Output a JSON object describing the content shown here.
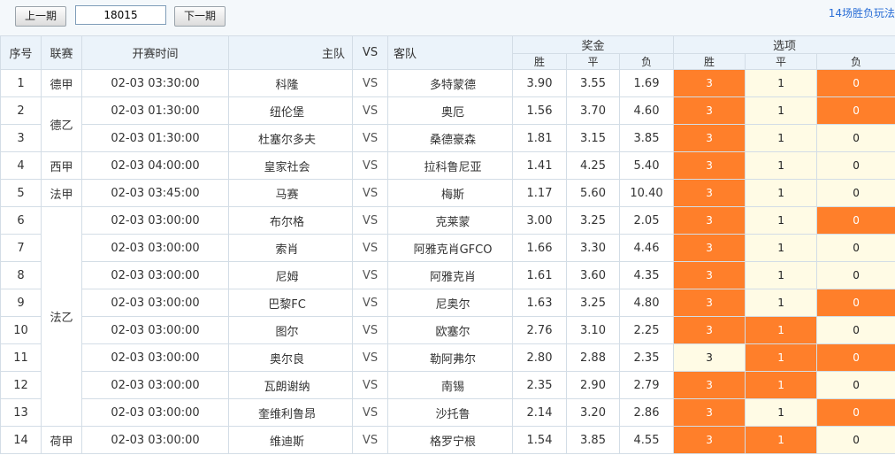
{
  "nav": {
    "prev_label": "上一期",
    "period": "18015",
    "next_label": "下一期",
    "rules_link": "14场胜负玩法"
  },
  "headers": {
    "no": "序号",
    "league": "联赛",
    "time": "开赛时间",
    "home": "主队",
    "vs": "VS",
    "away": "客队",
    "bonus": "奖金",
    "options": "选项",
    "win": "胜",
    "draw": "平",
    "loss": "负"
  },
  "colors": {
    "selected": "#ff7f2a",
    "unselected": "#fffbe5",
    "header_bg": "#ebf3fa"
  },
  "matches": [
    {
      "no": "1",
      "league": "德甲",
      "time": "02-03 03:30:00",
      "home": "科隆",
      "vs": "VS",
      "away": "多特蒙德",
      "odds": [
        "3.90",
        "3.55",
        "1.69"
      ],
      "options": [
        "3",
        "1",
        "0"
      ],
      "selected": [
        true,
        false,
        true
      ]
    },
    {
      "no": "2",
      "league": "德乙",
      "time": "02-03 01:30:00",
      "home": "纽伦堡",
      "vs": "VS",
      "away": "奥厄",
      "odds": [
        "1.56",
        "3.70",
        "4.60"
      ],
      "options": [
        "3",
        "1",
        "0"
      ],
      "selected": [
        true,
        false,
        true
      ]
    },
    {
      "no": "3",
      "league": "德乙",
      "time": "02-03 01:30:00",
      "home": "杜塞尔多夫",
      "vs": "VS",
      "away": "桑德豪森",
      "odds": [
        "1.81",
        "3.15",
        "3.85"
      ],
      "options": [
        "3",
        "1",
        "0"
      ],
      "selected": [
        true,
        false,
        false
      ]
    },
    {
      "no": "4",
      "league": "西甲",
      "time": "02-03 04:00:00",
      "home": "皇家社会",
      "vs": "VS",
      "away": "拉科鲁尼亚",
      "odds": [
        "1.41",
        "4.25",
        "5.40"
      ],
      "options": [
        "3",
        "1",
        "0"
      ],
      "selected": [
        true,
        false,
        false
      ]
    },
    {
      "no": "5",
      "league": "法甲",
      "time": "02-03 03:45:00",
      "home": "马赛",
      "vs": "VS",
      "away": "梅斯",
      "odds": [
        "1.17",
        "5.60",
        "10.40"
      ],
      "options": [
        "3",
        "1",
        "0"
      ],
      "selected": [
        true,
        false,
        false
      ]
    },
    {
      "no": "6",
      "league": "法乙",
      "time": "02-03 03:00:00",
      "home": "布尔格",
      "vs": "VS",
      "away": "克莱蒙",
      "odds": [
        "3.00",
        "3.25",
        "2.05"
      ],
      "options": [
        "3",
        "1",
        "0"
      ],
      "selected": [
        true,
        false,
        true
      ]
    },
    {
      "no": "7",
      "league": "法乙",
      "time": "02-03 03:00:00",
      "home": "索肖",
      "vs": "VS",
      "away": "阿雅克肖GFCO",
      "odds": [
        "1.66",
        "3.30",
        "4.46"
      ],
      "options": [
        "3",
        "1",
        "0"
      ],
      "selected": [
        true,
        false,
        false
      ]
    },
    {
      "no": "8",
      "league": "法乙",
      "time": "02-03 03:00:00",
      "home": "尼姆",
      "vs": "VS",
      "away": "阿雅克肖",
      "odds": [
        "1.61",
        "3.60",
        "4.35"
      ],
      "options": [
        "3",
        "1",
        "0"
      ],
      "selected": [
        true,
        false,
        false
      ]
    },
    {
      "no": "9",
      "league": "法乙",
      "time": "02-03 03:00:00",
      "home": "巴黎FC",
      "vs": "VS",
      "away": "尼奥尔",
      "odds": [
        "1.63",
        "3.25",
        "4.80"
      ],
      "options": [
        "3",
        "1",
        "0"
      ],
      "selected": [
        true,
        false,
        true
      ]
    },
    {
      "no": "10",
      "league": "法乙",
      "time": "02-03 03:00:00",
      "home": "图尔",
      "vs": "VS",
      "away": "欧塞尔",
      "odds": [
        "2.76",
        "3.10",
        "2.25"
      ],
      "options": [
        "3",
        "1",
        "0"
      ],
      "selected": [
        true,
        true,
        false
      ]
    },
    {
      "no": "11",
      "league": "法乙",
      "time": "02-03 03:00:00",
      "home": "奥尔良",
      "vs": "VS",
      "away": "勒阿弗尔",
      "odds": [
        "2.80",
        "2.88",
        "2.35"
      ],
      "options": [
        "3",
        "1",
        "0"
      ],
      "selected": [
        false,
        true,
        true
      ]
    },
    {
      "no": "12",
      "league": "法乙",
      "time": "02-03 03:00:00",
      "home": "瓦朗谢纳",
      "vs": "VS",
      "away": "南锡",
      "odds": [
        "2.35",
        "2.90",
        "2.79"
      ],
      "options": [
        "3",
        "1",
        "0"
      ],
      "selected": [
        true,
        true,
        false
      ]
    },
    {
      "no": "13",
      "league": "法乙",
      "time": "02-03 03:00:00",
      "home": "奎维利鲁昂",
      "vs": "VS",
      "away": "沙托鲁",
      "odds": [
        "2.14",
        "3.20",
        "2.86"
      ],
      "options": [
        "3",
        "1",
        "0"
      ],
      "selected": [
        true,
        false,
        true
      ]
    },
    {
      "no": "14",
      "league": "荷甲",
      "time": "02-03 03:00:00",
      "home": "维迪斯",
      "vs": "VS",
      "away": "格罗宁根",
      "odds": [
        "1.54",
        "3.85",
        "4.55"
      ],
      "options": [
        "3",
        "1",
        "0"
      ],
      "selected": [
        true,
        true,
        false
      ]
    }
  ]
}
